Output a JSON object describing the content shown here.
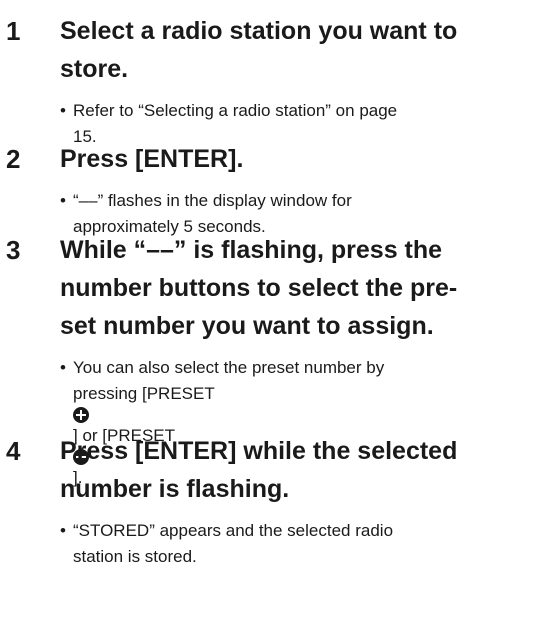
{
  "steps": [
    {
      "number": "1",
      "heading_lines": [
        "Select a radio station you want to",
        "store."
      ],
      "bullet_lines": [
        "Refer to “Selecting a radio station” on page",
        "15."
      ]
    },
    {
      "number": "2",
      "heading_lines": [
        "Press [ENTER]."
      ],
      "bullet_lines": [
        "“––” flashes in the display window for",
        "approximately 5 seconds."
      ]
    },
    {
      "number": "3",
      "heading_lines": [
        "While “––” is flashing, press the",
        "number buttons to select the pre-",
        "set number you want to assign."
      ],
      "bullet_line1": "You can also select the preset number by",
      "bullet_line2_prefix": "pressing [PRESET ",
      "bullet_line2_middle": "] or [PRESET ",
      "bullet_line2_suffix": "].",
      "icons": [
        "plus-circle-icon",
        "minus-circle-icon"
      ]
    },
    {
      "number": "4",
      "heading_lines": [
        "Press [ENTER] while the selected",
        "number is flashing."
      ],
      "bullet_lines": [
        "“STORED” appears and the selected radio",
        "station is stored."
      ]
    }
  ]
}
